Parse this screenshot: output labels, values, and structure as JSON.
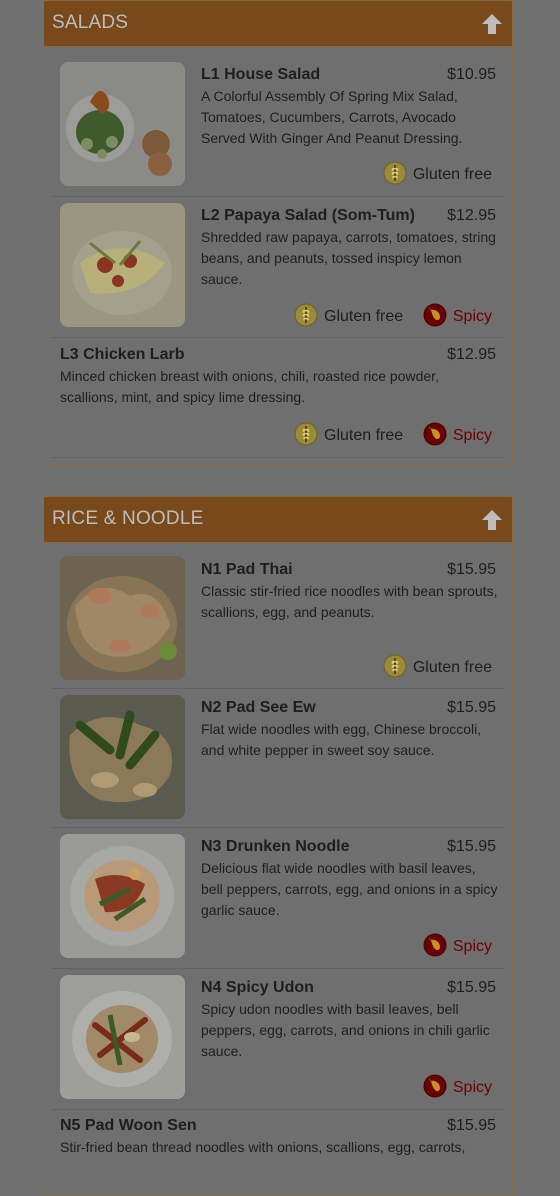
{
  "colors": {
    "header_bg": "#784a1b",
    "page_bg": "#707070",
    "spicy_text": "#6e0000"
  },
  "tags": {
    "gluten_free": "Gluten free",
    "spicy": "Spicy"
  },
  "salads": {
    "title": "SALADS",
    "items": [
      {
        "name": "L1 House Salad",
        "price": "$10.95",
        "desc": "A Colorful Assembly Of Spring Mix Salad, Tomatoes, Cucumbers, Carrots, Avocado Served With Ginger And Peanut Dressing."
      },
      {
        "name": "L2 Papaya Salad (Som-Tum)",
        "price": "$12.95",
        "desc": "Shredded raw papaya, carrots, tomatoes, string beans, and peanuts, tossed inspicy lemon sauce."
      },
      {
        "name": "L3 Chicken Larb",
        "price": "$12.95",
        "desc": "Minced chicken breast with onions, chili, roasted rice powder, scallions, mint, and spicy lime dressing."
      }
    ]
  },
  "rice": {
    "title": "RICE & NOODLE",
    "items": [
      {
        "name": "N1 Pad Thai",
        "price": "$15.95",
        "desc": "Classic stir-fried rice noodles with bean sprouts, scallions, egg, and peanuts."
      },
      {
        "name": "N2 Pad See Ew",
        "price": "$15.95",
        "desc": "Flat wide noodles with egg, Chinese broccoli, and white pepper in sweet soy sauce."
      },
      {
        "name": "N3 Drunken Noodle",
        "price": "$15.95",
        "desc": "Delicious flat wide noodles with basil leaves, bell peppers, carrots, egg, and onions in a spicy garlic sauce."
      },
      {
        "name": "N4 Spicy Udon",
        "price": "$15.95",
        "desc": "Spicy udon noodles with basil leaves, bell peppers, egg, carrots, and onions in chili garlic sauce."
      },
      {
        "name": "N5 Pad Woon Sen",
        "price": "$15.95",
        "desc": "Stir-fried bean thread noodles with onions, scallions, egg, carrots,"
      }
    ]
  }
}
